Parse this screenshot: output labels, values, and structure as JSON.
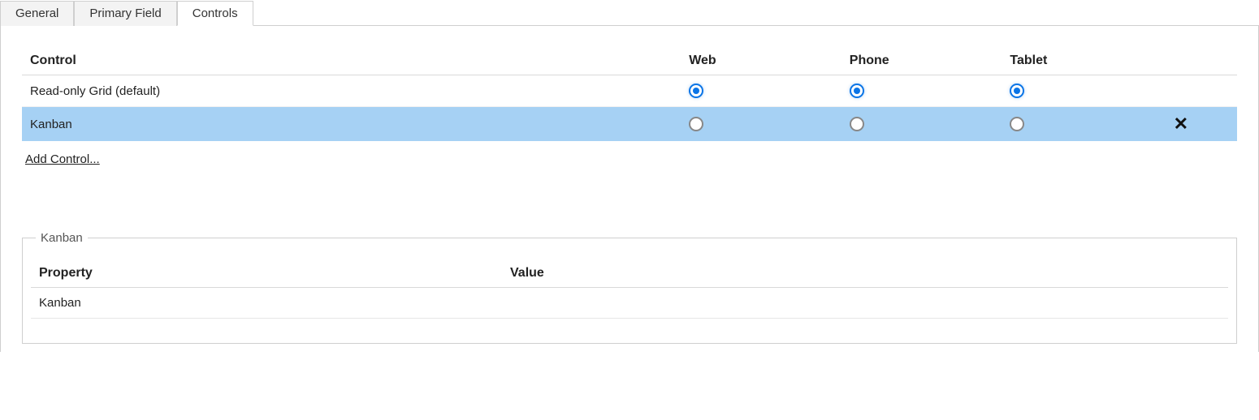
{
  "tabs": {
    "general": "General",
    "primary_field": "Primary Field",
    "controls": "Controls"
  },
  "controls_table": {
    "headers": {
      "control": "Control",
      "web": "Web",
      "phone": "Phone",
      "tablet": "Tablet"
    },
    "rows": [
      {
        "name": "Read-only Grid (default)",
        "selected": true,
        "highlighted": false,
        "deletable": false
      },
      {
        "name": "Kanban",
        "selected": false,
        "highlighted": true,
        "deletable": true
      }
    ],
    "add_control_label": "Add Control..."
  },
  "details": {
    "legend": "Kanban",
    "headers": {
      "property": "Property",
      "value": "Value"
    },
    "rows": [
      {
        "property": "Kanban",
        "value": ""
      }
    ]
  },
  "icons": {
    "delete": "✕"
  }
}
